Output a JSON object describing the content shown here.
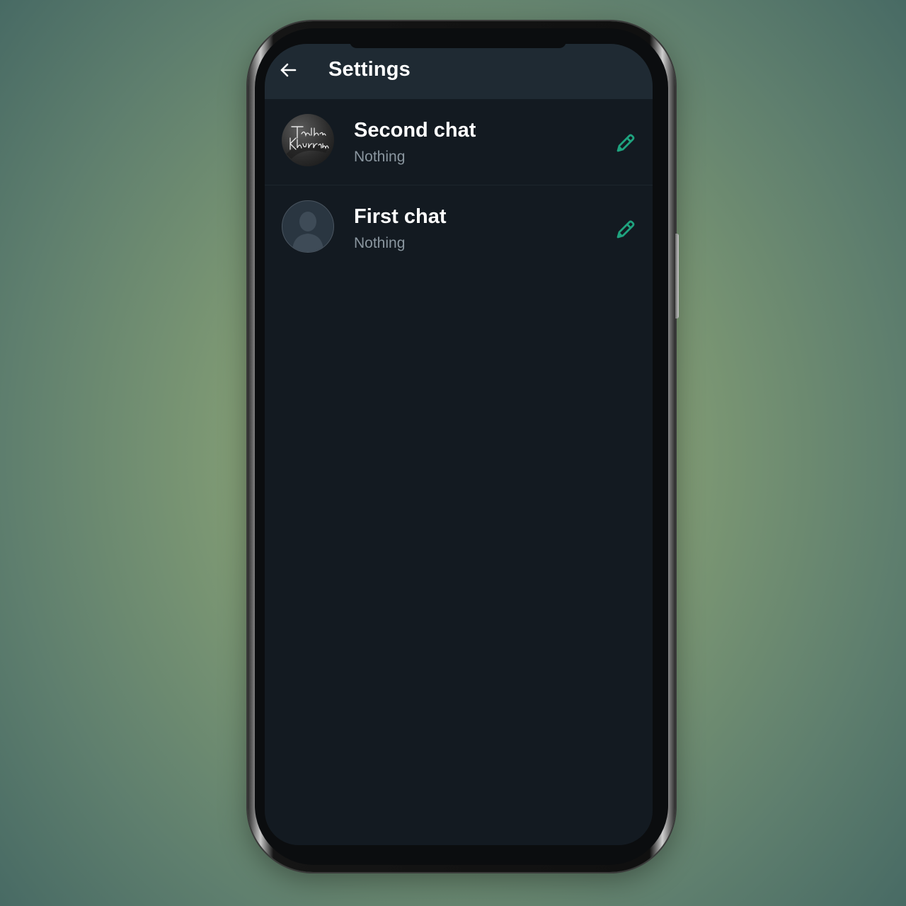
{
  "header": {
    "back_icon": "arrow-left-icon",
    "title": "Settings"
  },
  "chats": [
    {
      "name": "Second chat",
      "status": "Nothing",
      "avatar": "photo",
      "avatar_text": "Talha Khurram",
      "edit_icon": "pencil-icon"
    },
    {
      "name": "First chat",
      "status": "Nothing",
      "avatar": "default-person",
      "edit_icon": "pencil-icon"
    }
  ],
  "colors": {
    "accent": "#1fa37f",
    "header_bg": "#1f2a33",
    "screen_bg": "#131a21",
    "status_text": "#8a969f"
  }
}
